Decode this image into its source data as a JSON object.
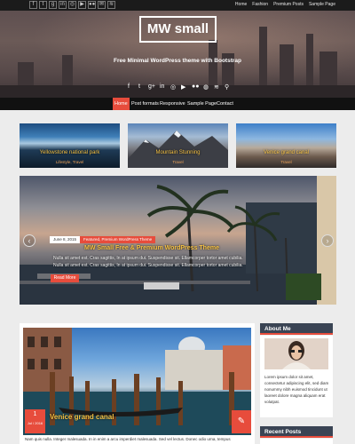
{
  "topbar": {
    "social_icons": [
      "facebook-icon",
      "twitter-icon",
      "google-plus-icon",
      "linkedin-icon",
      "instagram-icon",
      "youtube-icon",
      "flickr-icon",
      "email-icon",
      "rss-icon"
    ],
    "social_glyphs": [
      "f",
      "t",
      "g",
      "in",
      "◎",
      "▶",
      "●●",
      "✉",
      "≋"
    ],
    "links": [
      "Home",
      "Fashion",
      "Premium Posts",
      "Sample Page"
    ]
  },
  "header": {
    "site_title": "MW small",
    "tagline": "Free Minimal WordPress theme with Bootstrap",
    "social_icons": [
      "facebook-icon",
      "twitter-icon",
      "google-plus-icon",
      "linkedin-icon",
      "instagram-icon",
      "youtube-icon",
      "flickr-icon",
      "dribbble-icon",
      "rss-icon",
      "search-icon"
    ],
    "social_glyphs": [
      "f",
      "t",
      "g+",
      "in",
      "◎",
      "▶",
      "●●",
      "◍",
      "≋",
      "⚲"
    ]
  },
  "nav": {
    "items": [
      "Home",
      "Post formats",
      "Responsive",
      "Sample Page",
      "Contact"
    ],
    "active": "Home"
  },
  "featured": [
    {
      "title": "Yellowstone national park",
      "category": "Lifestyle, Travel"
    },
    {
      "title": "Mountain Stunning",
      "category": "Travel"
    },
    {
      "title": "Venice grand canal",
      "category": "Travel"
    }
  ],
  "slider": {
    "date": "June 8, 2015",
    "categories": "Featured, Premium WordPress Theme",
    "title": "MW Small Free & Premium WordPress Theme",
    "excerpt_lines": [
      "Nulla sit amet est. Cras sagittis, In at ipsum dui. Suspendisse sit. Ellamcorper tortor amet cubilia.",
      "Nulla sit amet est. Cras sagittis, In at ipsum dui. Suspendisse sit. Ellamcorper tortor amet cubilia."
    ],
    "read_more": "Read More",
    "prev_glyph": "‹",
    "next_glyph": "›"
  },
  "post": {
    "day": "1",
    "month_year": "Jul / 2016",
    "title": "Venice grand canal",
    "edit_glyph": "✎",
    "excerpt": "Nam quis nulla. Integer malesuada. In in enim a arcu imperdiet malesuada. Sed vel lectus. Donec odio urna, tempus"
  },
  "sidebar": {
    "about_title": "About Me",
    "about_text": "Lorem ipsum dolor sit amet, consectetur adipiscing elit, sed diam nonummy nibh euismod tincidunt ut laoreet dolore magna aliquam erat volutpat.",
    "recent_title": "Recent Posts"
  },
  "colors": {
    "accent": "#e74c3c",
    "caption_yellow": "#f6c244",
    "widget_header": "#3a4454",
    "nav_bg": "#111111"
  }
}
